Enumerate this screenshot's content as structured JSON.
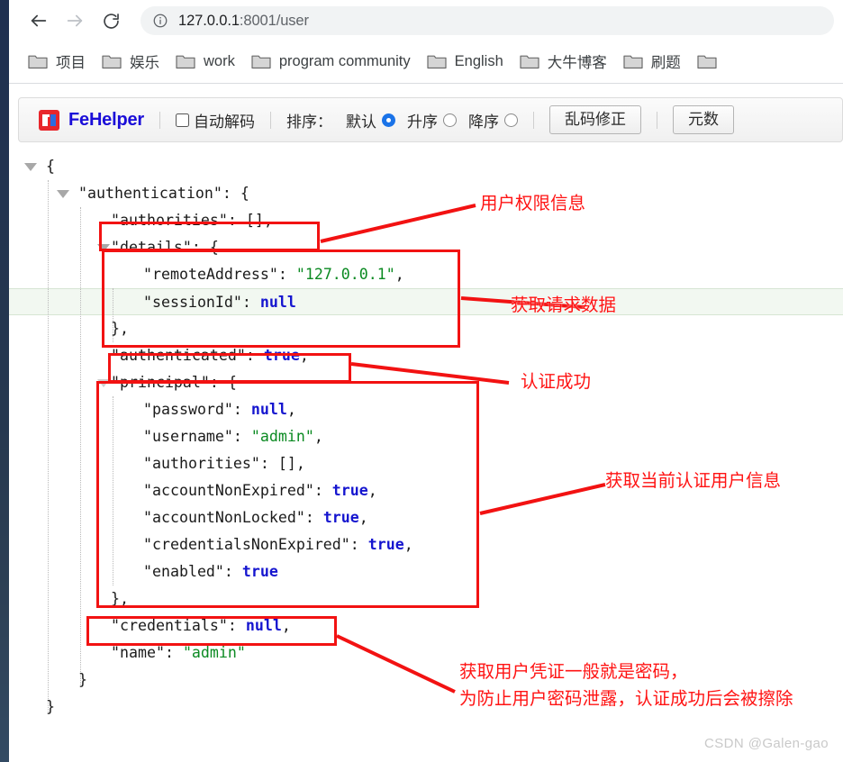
{
  "browser": {
    "back_icon": "arrow-left-icon",
    "forward_icon": "arrow-right-icon",
    "reload_icon": "reload-icon",
    "info_icon": "info-circle-icon",
    "url_host": "127.0.0.1",
    "url_rest": ":8001/user",
    "url_full": "127.0.0.1:8001/user",
    "bookmarks": [
      {
        "label": "项目"
      },
      {
        "label": "娱乐"
      },
      {
        "label": "work"
      },
      {
        "label": "program community"
      },
      {
        "label": "English"
      },
      {
        "label": "大牛博客"
      },
      {
        "label": "刷题"
      },
      {
        "label": ""
      }
    ]
  },
  "fehelper": {
    "logo_text": "FE",
    "name": "FeHelper",
    "auto_decode_label": "自动解码",
    "auto_decode_checked": false,
    "sort_label": "排序：",
    "sort_options": [
      {
        "label": "默认",
        "selected": true
      },
      {
        "label": "升序",
        "selected": false
      },
      {
        "label": "降序",
        "selected": false
      }
    ],
    "fix_garbled_button": "乱码修正",
    "metadata_button": "元数"
  },
  "json_view": {
    "rows": [
      {
        "indent": 0,
        "text": "{",
        "parts": [
          {
            "t": "{",
            "c": "p"
          }
        ]
      },
      {
        "indent": 1,
        "text": "\"authentication\": {",
        "parts": [
          {
            "t": "\"authentication\": {",
            "c": "k"
          }
        ]
      },
      {
        "indent": 2,
        "text": "\"authorities\": [],",
        "parts": [
          {
            "t": "\"authorities\": [],",
            "c": "k"
          }
        ]
      },
      {
        "indent": 2,
        "text": "\"details\": {",
        "parts": [
          {
            "t": "\"details\": {",
            "c": "k"
          }
        ]
      },
      {
        "indent": 3,
        "text": "\"remoteAddress\": \"127.0.0.1\",",
        "parts": [
          {
            "t": "\"remoteAddress\": ",
            "c": "k"
          },
          {
            "t": "\"127.0.0.1\"",
            "c": "v-str"
          },
          {
            "t": ",",
            "c": "k"
          }
        ]
      },
      {
        "indent": 3,
        "text": "\"sessionId\": null",
        "highlight": true,
        "parts": [
          {
            "t": "\"sessionId\": ",
            "c": "k"
          },
          {
            "t": "null",
            "c": "v-kw"
          }
        ]
      },
      {
        "indent": 2,
        "text": "},",
        "parts": [
          {
            "t": "},",
            "c": "p"
          }
        ]
      },
      {
        "indent": 2,
        "text": "\"authenticated\": true,",
        "parts": [
          {
            "t": "\"authenticated\": ",
            "c": "k"
          },
          {
            "t": "true",
            "c": "v-kw"
          },
          {
            "t": ",",
            "c": "k"
          }
        ]
      },
      {
        "indent": 2,
        "text": "\"principal\": {",
        "parts": [
          {
            "t": "\"principal\": {",
            "c": "k"
          }
        ]
      },
      {
        "indent": 3,
        "text": "\"password\": null,",
        "parts": [
          {
            "t": "\"password\": ",
            "c": "k"
          },
          {
            "t": "null",
            "c": "v-kw"
          },
          {
            "t": ",",
            "c": "k"
          }
        ]
      },
      {
        "indent": 3,
        "text": "\"username\": \"admin\",",
        "parts": [
          {
            "t": "\"username\": ",
            "c": "k"
          },
          {
            "t": "\"admin\"",
            "c": "v-str"
          },
          {
            "t": ",",
            "c": "k"
          }
        ]
      },
      {
        "indent": 3,
        "text": "\"authorities\": [],",
        "parts": [
          {
            "t": "\"authorities\": [],",
            "c": "k"
          }
        ]
      },
      {
        "indent": 3,
        "text": "\"accountNonExpired\": true,",
        "parts": [
          {
            "t": "\"accountNonExpired\": ",
            "c": "k"
          },
          {
            "t": "true",
            "c": "v-kw"
          },
          {
            "t": ",",
            "c": "k"
          }
        ]
      },
      {
        "indent": 3,
        "text": "\"accountNonLocked\": true,",
        "parts": [
          {
            "t": "\"accountNonLocked\": ",
            "c": "k"
          },
          {
            "t": "true",
            "c": "v-kw"
          },
          {
            "t": ",",
            "c": "k"
          }
        ]
      },
      {
        "indent": 3,
        "text": "\"credentialsNonExpired\": true,",
        "parts": [
          {
            "t": "\"credentialsNonExpired\": ",
            "c": "k"
          },
          {
            "t": "true",
            "c": "v-kw"
          },
          {
            "t": ",",
            "c": "k"
          }
        ]
      },
      {
        "indent": 3,
        "text": "\"enabled\": true",
        "parts": [
          {
            "t": "\"enabled\": ",
            "c": "k"
          },
          {
            "t": "true",
            "c": "v-kw"
          }
        ]
      },
      {
        "indent": 2,
        "text": "},",
        "parts": [
          {
            "t": "},",
            "c": "p"
          }
        ]
      },
      {
        "indent": 2,
        "text": "\"credentials\": null,",
        "parts": [
          {
            "t": "\"credentials\": ",
            "c": "k"
          },
          {
            "t": "null",
            "c": "v-kw"
          },
          {
            "t": ",",
            "c": "k"
          }
        ]
      },
      {
        "indent": 2,
        "text": "\"name\": \"admin\"",
        "parts": [
          {
            "t": "\"name\": ",
            "c": "k"
          },
          {
            "t": "\"admin\"",
            "c": "v-str"
          }
        ]
      },
      {
        "indent": 1,
        "text": "}",
        "parts": [
          {
            "t": "}",
            "c": "p"
          }
        ]
      },
      {
        "indent": 0,
        "text": "}",
        "parts": [
          {
            "t": "}",
            "c": "p"
          }
        ]
      }
    ]
  },
  "annotations": {
    "accent_color": "#f21212",
    "labels": [
      {
        "id": "user-authorities-note",
        "text": "用户权限信息"
      },
      {
        "id": "request-data-note",
        "text": "获取请求数据"
      },
      {
        "id": "auth-success-note",
        "text": "认证成功"
      },
      {
        "id": "current-user-note",
        "text": "获取当前认证用户信息"
      },
      {
        "id": "credentials-note-line1",
        "text": "获取用户凭证一般就是密码，"
      },
      {
        "id": "credentials-note-line2",
        "text": "为防止用户密码泄露，认证成功后会被擦除"
      }
    ]
  },
  "watermark": {
    "text": "CSDN @Galen-gao"
  }
}
